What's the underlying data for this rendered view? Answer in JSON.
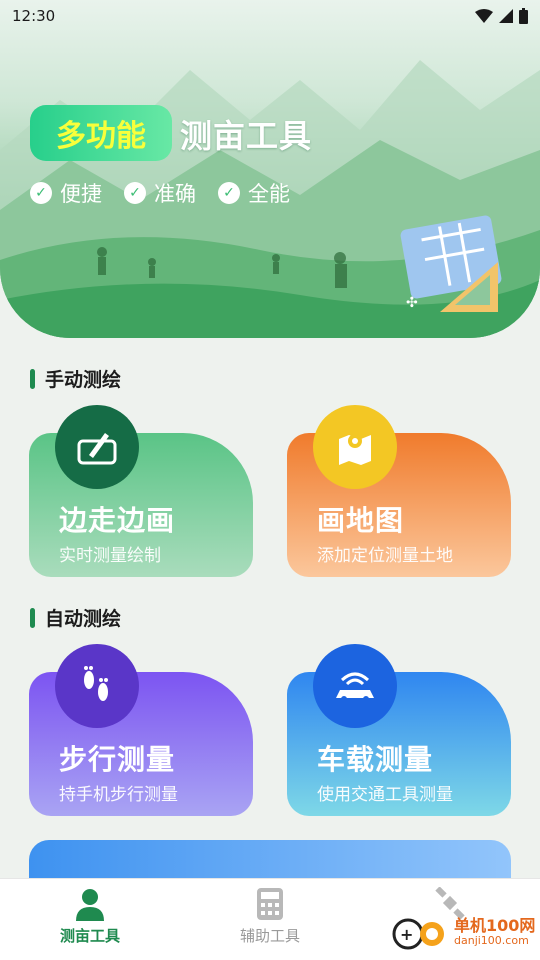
{
  "status_bar": {
    "time": "12:30"
  },
  "hero": {
    "badge": "多功能",
    "title": "测亩工具",
    "tags": [
      "便捷",
      "准确",
      "全能"
    ]
  },
  "sections": [
    {
      "title": "手动测绘",
      "cards": [
        {
          "title": "边走边画",
          "subtitle": "实时测量绘制",
          "icon": "draw-pen-icon"
        },
        {
          "title": "画地图",
          "subtitle": "添加定位测量土地",
          "icon": "map-pin-icon"
        }
      ]
    },
    {
      "title": "自动测绘",
      "cards": [
        {
          "title": "步行测量",
          "subtitle": "持手机步行测量",
          "icon": "footprints-icon"
        },
        {
          "title": "车载测量",
          "subtitle": "使用交通工具测量",
          "icon": "car-signal-icon"
        }
      ]
    }
  ],
  "tabbar": {
    "items": [
      {
        "label": "测亩工具",
        "icon": "user-icon",
        "active": true
      },
      {
        "label": "辅助工具",
        "icon": "calculator-icon",
        "active": false
      },
      {
        "label": "",
        "icon": "satellite-icon",
        "active": false
      }
    ]
  },
  "watermark": {
    "name": "单机100网",
    "url": "danji100.com"
  },
  "colors": {
    "accent": "#1f8a4f",
    "badge_text": "#f8ff3b"
  }
}
